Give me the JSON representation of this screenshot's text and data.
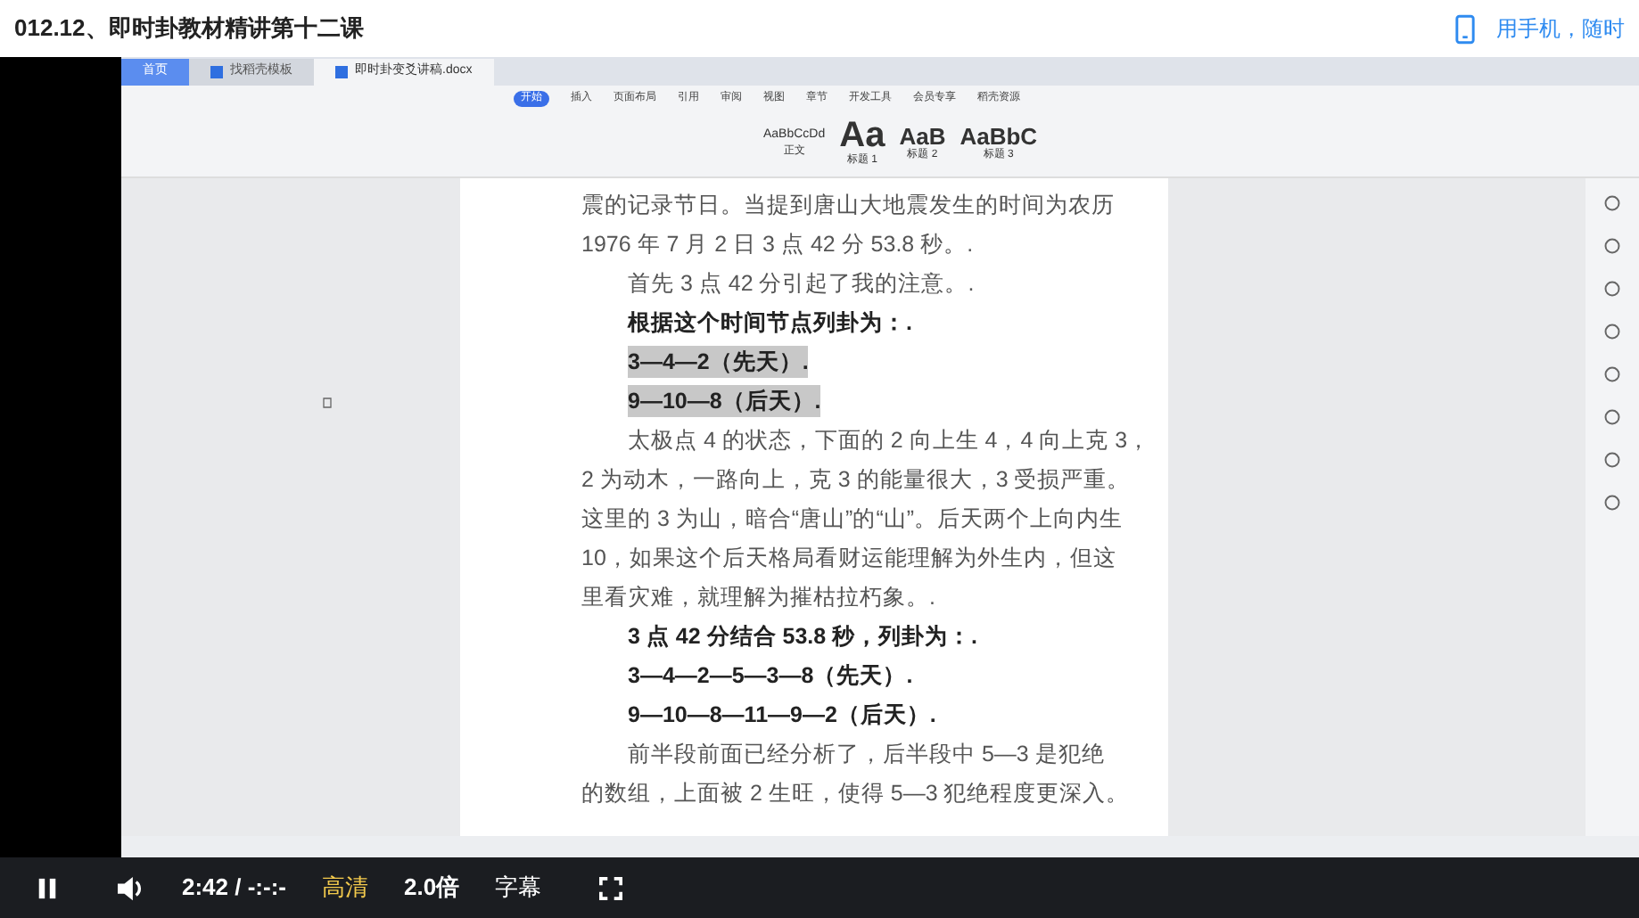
{
  "header": {
    "title": "012.12、即时卦教材精讲第十二课",
    "mobile_link": "用手机，随时"
  },
  "editor": {
    "tabs": [
      {
        "label": "首页",
        "selected": false,
        "kind": "home"
      },
      {
        "label": "找稻壳模板",
        "selected": false,
        "kind": "doc"
      },
      {
        "label": "即时卦变爻讲稿.docx",
        "selected": true,
        "kind": "doc"
      }
    ],
    "ribbon_tabs": [
      {
        "label": "开始",
        "selected": true
      },
      {
        "label": "插入",
        "selected": false
      },
      {
        "label": "页面布局",
        "selected": false
      },
      {
        "label": "引用",
        "selected": false
      },
      {
        "label": "审阅",
        "selected": false
      },
      {
        "label": "视图",
        "selected": false
      },
      {
        "label": "章节",
        "selected": false
      },
      {
        "label": "开发工具",
        "selected": false
      },
      {
        "label": "会员专享",
        "selected": false
      },
      {
        "label": "稻壳资源",
        "selected": false
      }
    ],
    "styles": [
      {
        "sample": "AaBbCcDd",
        "name": "正文",
        "kind": "small"
      },
      {
        "sample": "Aa",
        "name": "标题 1",
        "kind": "large"
      },
      {
        "sample": "AaB",
        "name": "标题 2",
        "kind": "medium"
      },
      {
        "sample": "AaBbC",
        "name": "标题 3",
        "kind": "medium"
      }
    ],
    "lines": [
      {
        "text": "震的记录节日。当提到唐山大地震发生的时间为农历",
        "bold": false,
        "indent": false,
        "highlighted": false
      },
      {
        "text": "1976 年 7 月 2 日 3 点 42 分 53.8 秒。.",
        "bold": false,
        "indent": false,
        "highlighted": false
      },
      {
        "text": "首先 3 点 42 分引起了我的注意。.",
        "bold": false,
        "indent": true,
        "highlighted": false
      },
      {
        "text": "根据这个时间节点列卦为：.",
        "bold": true,
        "indent": true,
        "highlighted": false
      },
      {
        "text": "3—4—2（先天）.",
        "bold": true,
        "indent": true,
        "highlighted": true
      },
      {
        "text": "9—10—8（后天）.",
        "bold": true,
        "indent": true,
        "highlighted": true
      },
      {
        "text": "太极点 4 的状态，下面的 2 向上生 4，4 向上克 3，",
        "bold": false,
        "indent": true,
        "highlighted": false
      },
      {
        "text": "2 为动木，一路向上，克 3 的能量很大，3 受损严重。",
        "bold": false,
        "indent": false,
        "highlighted": false
      },
      {
        "text": "这里的 3 为山，暗合“唐山”的“山”。后天两个上向内生",
        "bold": false,
        "indent": false,
        "highlighted": false
      },
      {
        "text": "10，如果这个后天格局看财运能理解为外生内，但这",
        "bold": false,
        "indent": false,
        "highlighted": false
      },
      {
        "text": "里看灾难，就理解为摧枯拉朽象。.",
        "bold": false,
        "indent": false,
        "highlighted": false
      },
      {
        "text": "3 点 42 分结合 53.8 秒，列卦为：.",
        "bold": true,
        "indent": true,
        "highlighted": false
      },
      {
        "text": "3—4—2—5—3—8（先天）.",
        "bold": true,
        "indent": true,
        "highlighted": false
      },
      {
        "text": "9—10—8—11—9—2（后天）.",
        "bold": true,
        "indent": true,
        "highlighted": false
      },
      {
        "text": "前半段前面已经分析了，后半段中 5—3 是犯绝",
        "bold": false,
        "indent": true,
        "highlighted": false
      },
      {
        "text": "的数组，上面被 2 生旺，使得 5—3 犯绝程度更深入。",
        "bold": false,
        "indent": false,
        "highlighted": false
      }
    ]
  },
  "player": {
    "playing": true,
    "time": "2:42 / -:-:-",
    "quality": "高清",
    "speed": "2.0倍",
    "subtitles": "字幕"
  }
}
